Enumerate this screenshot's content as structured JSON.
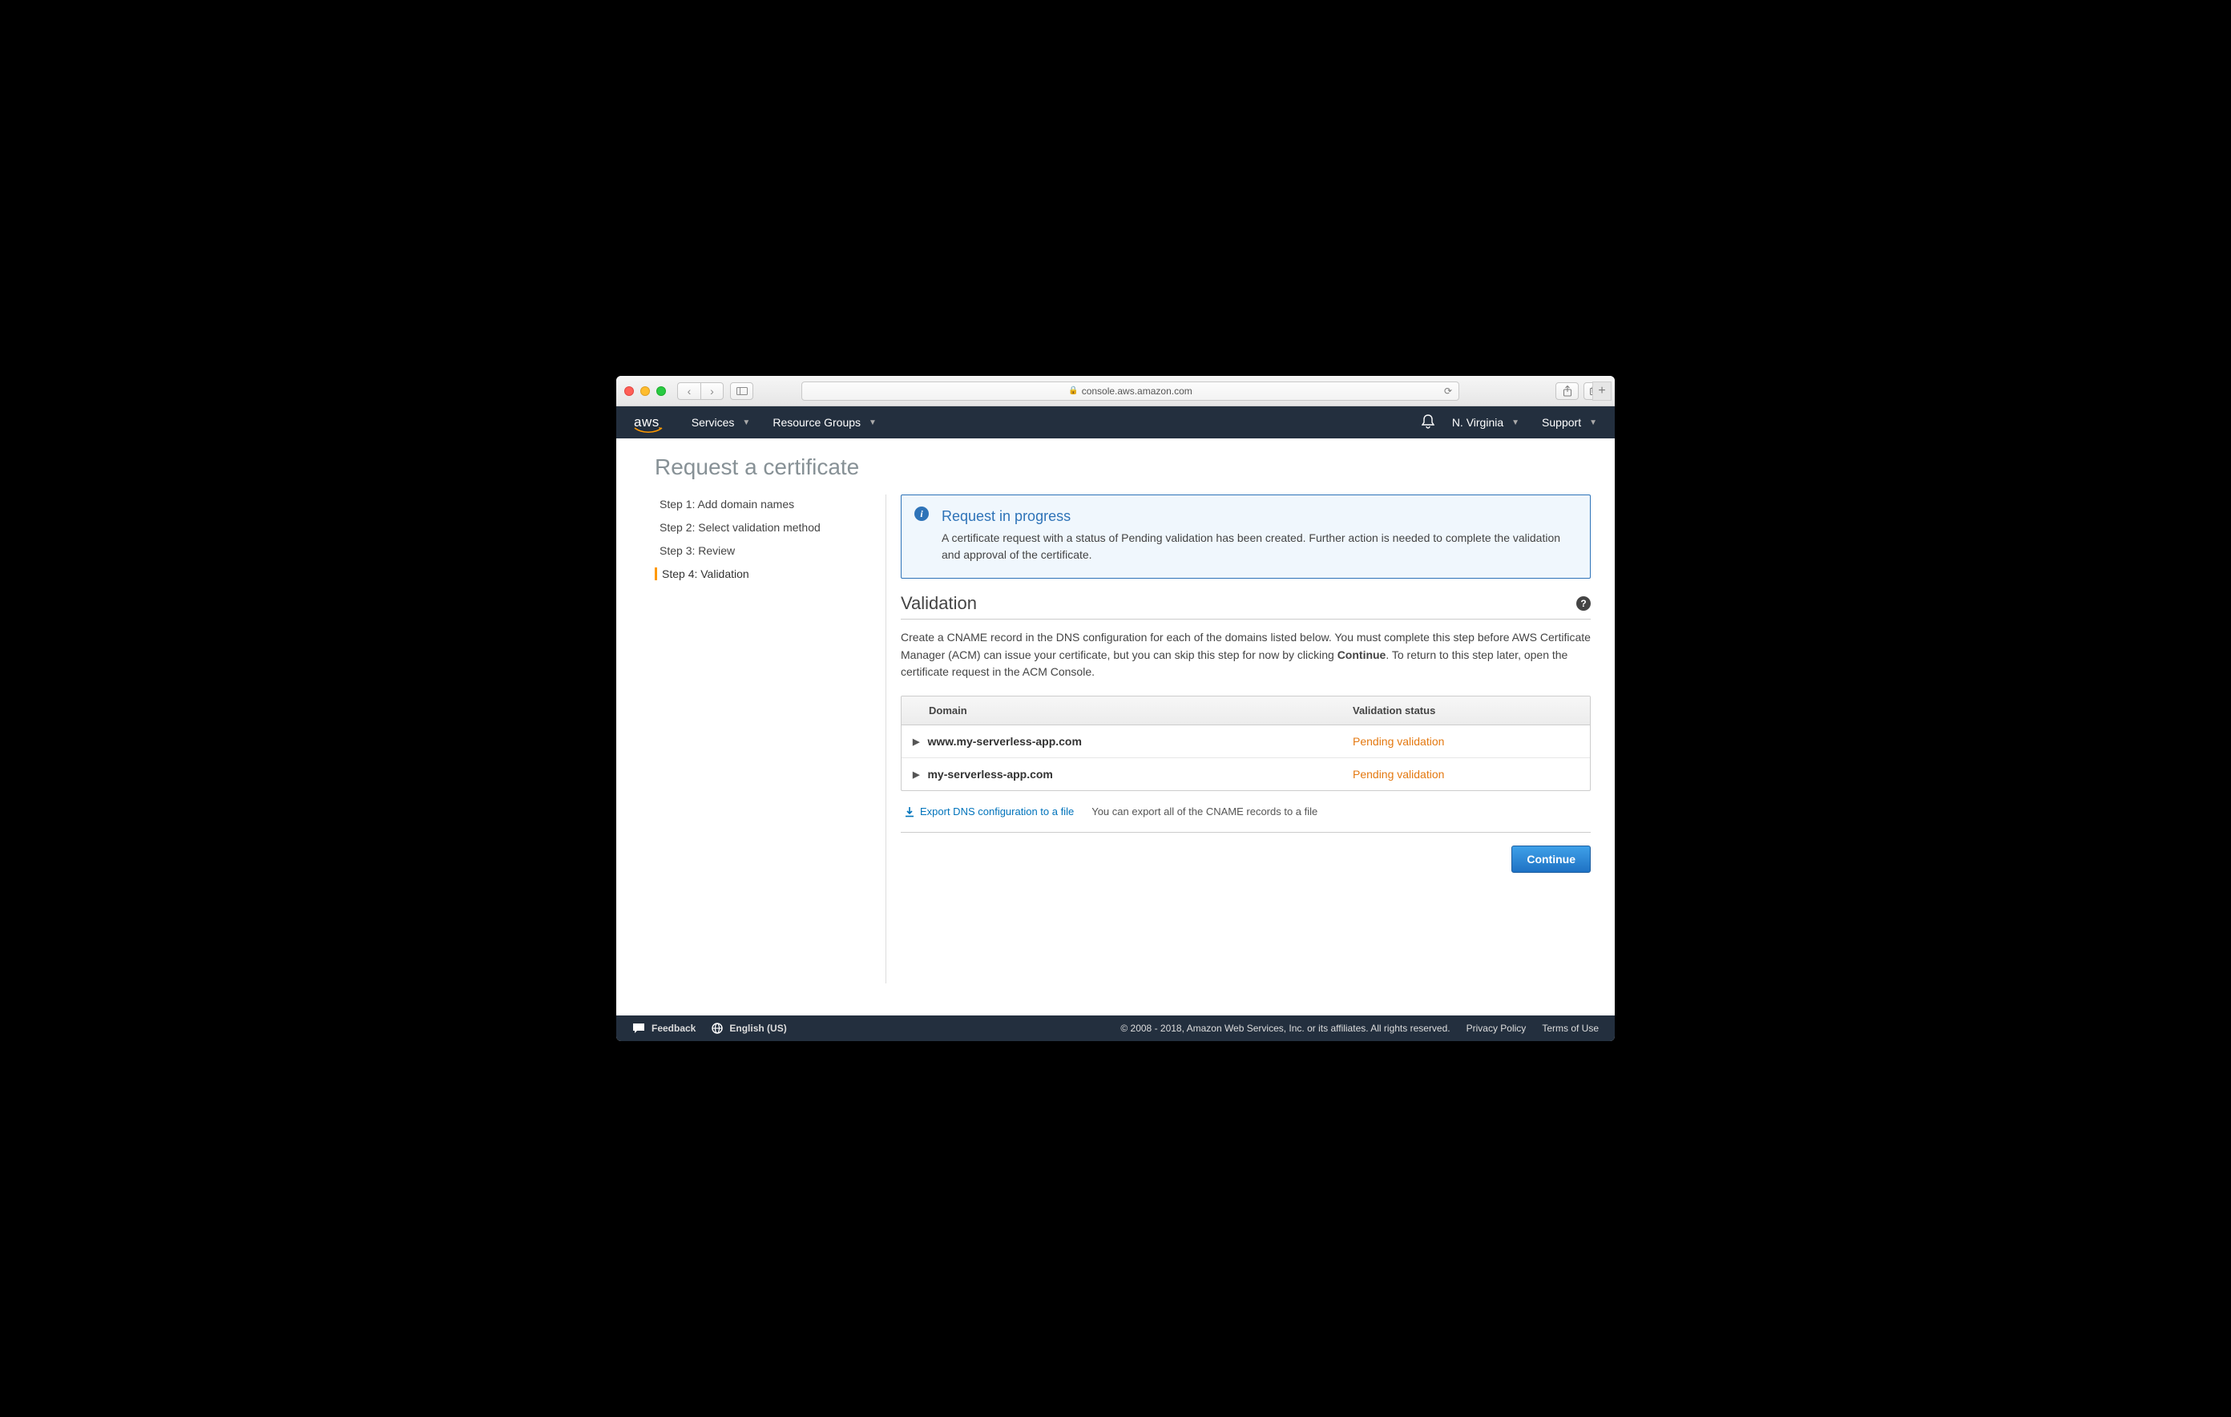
{
  "browser": {
    "url_host": "console.aws.amazon.com"
  },
  "header": {
    "services": "Services",
    "resource_groups": "Resource Groups",
    "region": "N. Virginia",
    "support": "Support"
  },
  "page": {
    "title": "Request a certificate"
  },
  "steps": [
    {
      "label": "Step 1: Add domain names",
      "active": false
    },
    {
      "label": "Step 2: Select validation method",
      "active": false
    },
    {
      "label": "Step 3: Review",
      "active": false
    },
    {
      "label": "Step 4: Validation",
      "active": true
    }
  ],
  "infobox": {
    "title": "Request in progress",
    "body": "A certificate request with a status of Pending validation has been created. Further action is needed to complete the validation and approval of the certificate."
  },
  "section": {
    "title": "Validation",
    "desc_pre": "Create a CNAME record in the DNS configuration for each of the domains listed below. You must complete this step before AWS Certificate Manager (ACM) can issue your certificate, but you can skip this step for now by clicking ",
    "desc_bold": "Continue",
    "desc_post": ". To return to this step later, open the certificate request in the ACM Console."
  },
  "table": {
    "col_domain": "Domain",
    "col_status": "Validation status",
    "rows": [
      {
        "domain": "www.my-serverless-app.com",
        "status": "Pending validation"
      },
      {
        "domain": "my-serverless-app.com",
        "status": "Pending validation"
      }
    ]
  },
  "export": {
    "link": "Export DNS configuration to a file",
    "hint": "You can export all of the CNAME records to a file"
  },
  "buttons": {
    "continue": "Continue"
  },
  "footer": {
    "feedback": "Feedback",
    "language": "English (US)",
    "copyright": "© 2008 - 2018, Amazon Web Services, Inc. or its affiliates. All rights reserved.",
    "privacy": "Privacy Policy",
    "terms": "Terms of Use"
  }
}
